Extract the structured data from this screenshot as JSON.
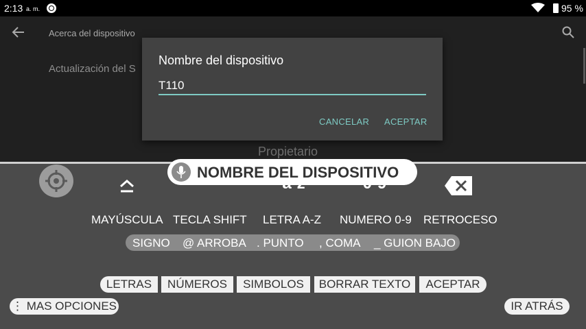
{
  "status_bar": {
    "time": "2:13",
    "ampm": "a. m.",
    "battery": "95 %"
  },
  "settings": {
    "title": "Acerca del dispositivo",
    "item_update": "Actualización del S",
    "item_owner": "Propietario"
  },
  "dialog": {
    "title": "Nombre del dispositivo",
    "input_value": "T110",
    "cancel_label": "CANCELAR",
    "accept_label": "ACEPTAR",
    "accent_color": "#7ecbc4"
  },
  "voice_access": {
    "spoken_text": "NOMBRE DEL DISPOSITIVO",
    "az_icon": "a-z",
    "num_icon": "0-9",
    "commands": [
      "MAYÚSCULA",
      "TECLA SHIFT",
      "LETRA A-Z",
      "NUMERO 0-9",
      "RETROCESO"
    ],
    "symbols": [
      "SIGNO",
      "@ ARROBA",
      ". PUNTO",
      ", COMA",
      "_ GUION BAJO"
    ],
    "keyboard_modes": [
      "LETRAS",
      "NÚMEROS",
      "SIMBOLOS",
      "BORRAR TEXTO",
      "ACEPTAR"
    ],
    "more_options": "MAS OPCIONES",
    "go_back": "IR ATRÁS"
  }
}
